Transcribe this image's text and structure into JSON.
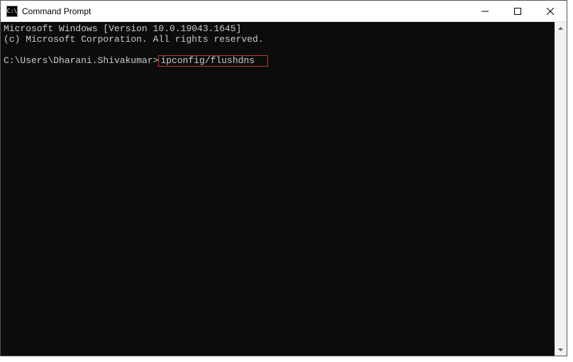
{
  "titlebar": {
    "icon_text": "C:\\",
    "title": "Command Prompt"
  },
  "terminal": {
    "line1": "Microsoft Windows [Version 10.0.19043.1645]",
    "line2": "(c) Microsoft Corporation. All rights reserved.",
    "blank": "",
    "prompt": "C:\\Users\\Dharani.Shivakumar>",
    "command": "ipconfig/flushdns",
    "trailing_space": "  "
  }
}
